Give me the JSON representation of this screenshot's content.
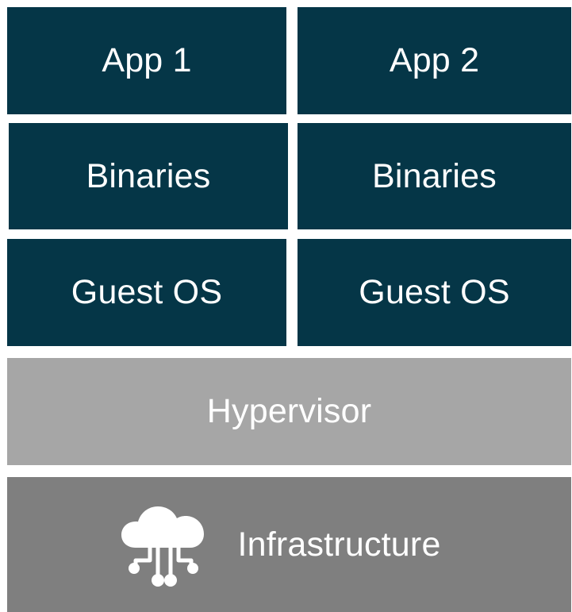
{
  "layers": {
    "app1": "App 1",
    "app2": "App 2",
    "binaries1": "Binaries",
    "binaries2": "Binaries",
    "guest_os1": "Guest OS",
    "guest_os2": "Guest OS",
    "hypervisor": "Hypervisor",
    "infrastructure": "Infrastructure"
  },
  "icons": {
    "infrastructure": "cloud-network-icon"
  },
  "colors": {
    "vm_block": "#053647",
    "hypervisor": "#a6a6a6",
    "infrastructure": "#7f7f7f",
    "text": "#ffffff"
  }
}
